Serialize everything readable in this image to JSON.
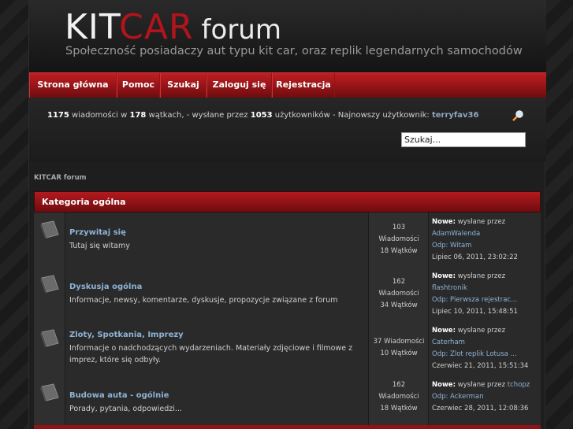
{
  "header": {
    "logo_kit": "KIT",
    "logo_car": "CAR",
    "logo_forum": "forum",
    "tagline": "Społeczność posiadaczy aut typu kit car, oraz replik legendarnych samochodów"
  },
  "nav": [
    {
      "label": "Strona główna"
    },
    {
      "label": "Pomoc"
    },
    {
      "label": "Szukaj"
    },
    {
      "label": "Zaloguj się"
    },
    {
      "label": "Rejestracja"
    }
  ],
  "stats": {
    "posts": "1175",
    "posts_text": "wiadomości w",
    "topics": "178",
    "topics_text": "wątkach, - wysłane przez",
    "members": "1053",
    "members_text": "użytkowników - Najnowszy użytkownik:",
    "newest_member": "terryfav36"
  },
  "search": {
    "value": "Szukaj...",
    "icon": "magnifier-icon"
  },
  "breadcrumb": "KITCAR forum",
  "category": {
    "title": "Kategoria ogólna"
  },
  "boards": [
    {
      "name": "Przywitaj się",
      "description": "Tutaj się witamy",
      "stats": [
        "103",
        "Wiadomości",
        "18 Wątków"
      ],
      "last_new": "Nowe:",
      "last_by": "wysłane przez",
      "last_author": "AdamWalenda",
      "last_topic": "Odp: Witam",
      "last_date": "Lipiec 06, 2011, 23:02:22"
    },
    {
      "name": "Dyskusja ogólna",
      "description": "Informacje, newsy, komentarze, dyskusje, propozycje związane z forum",
      "stats": [
        "162",
        "Wiadomości",
        "34 Wątków"
      ],
      "last_new": "Nowe:",
      "last_by": "wysłane przez",
      "last_author": "flashtronik",
      "last_topic": "Odp: Pierwsza rejestrac...",
      "last_date": "Lipiec 10, 2011, 15:48:51"
    },
    {
      "name": "Zloty, Spotkania, Imprezy",
      "description": "Informacje o nadchodzących wydarzeniach. Materiały zdjęciowe i filmowe z imprez, które się odbyły.",
      "stats": [
        "37 Wiadomości",
        "10 Wątków",
        ""
      ],
      "last_new": "Nowe:",
      "last_by": "wysłane przez",
      "last_author": "Caterham",
      "last_topic": "Odp: Zlot replik Lotusa ...",
      "last_date": "Czerwiec 21, 2011, 15:51:34"
    },
    {
      "name": "Budowa auta - ogólnie",
      "description": "Porady, pytania, odpowiedzi...",
      "stats": [
        "162",
        "Wiadomości",
        "18 Wątków"
      ],
      "last_new": "Nowe:",
      "last_by": "wysłane przez",
      "last_author": "tchopz",
      "last_topic": "Odp: Ackerman",
      "last_date": "Czerwiec 28, 2011, 12:08:36"
    }
  ],
  "colors": {
    "accent": "#b3141b",
    "link": "#8db3d6",
    "background": "#1e1e1e"
  }
}
